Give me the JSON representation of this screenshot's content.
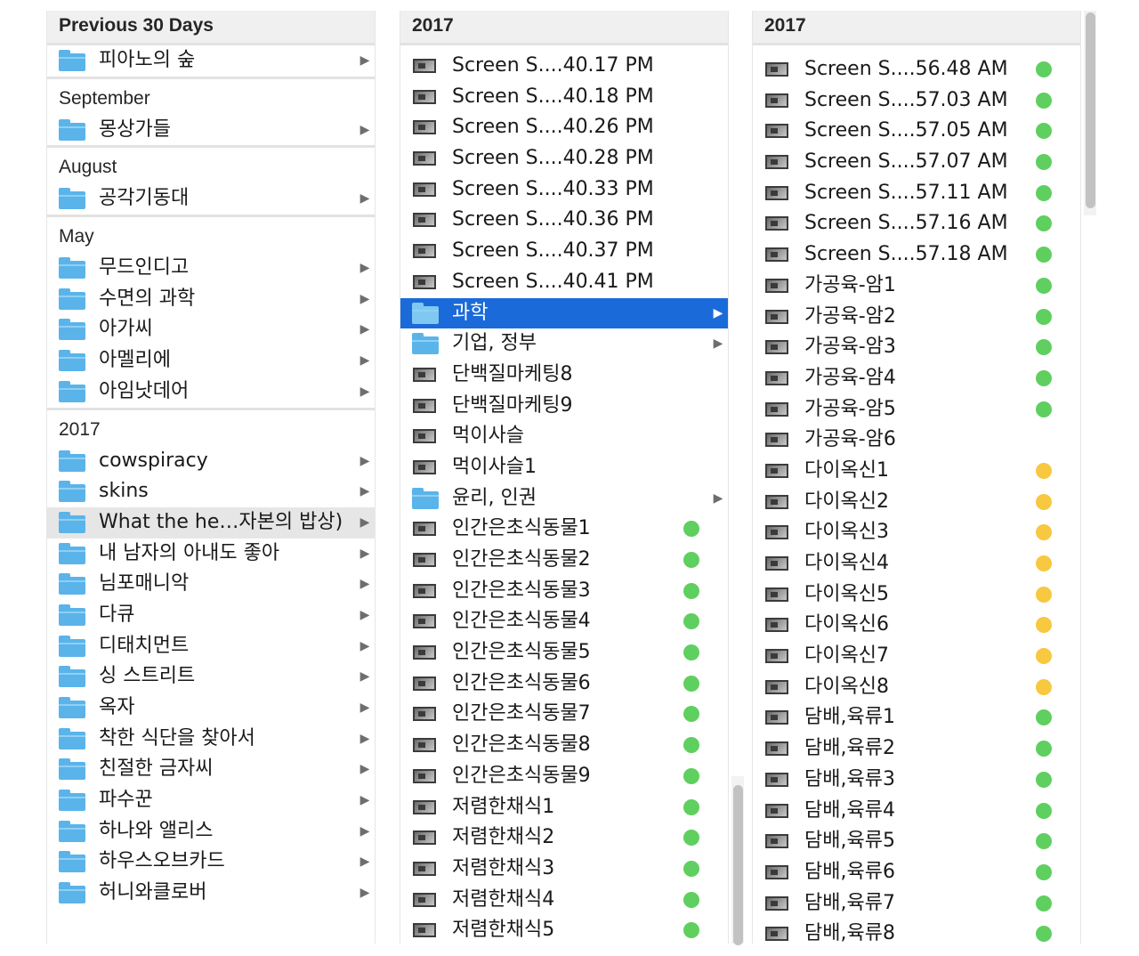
{
  "colors": {
    "green": "#5fcf5f",
    "yellow": "#f7c840",
    "selection": "#1b6ad9"
  },
  "columns": [
    {
      "header": "Previous 30 Days",
      "items": [
        {
          "label": "피아노의 숲"
        }
      ],
      "sections": [
        {
          "title": "September",
          "items": [
            {
              "label": "몽상가들"
            }
          ]
        },
        {
          "title": "August",
          "items": [
            {
              "label": "공각기동대"
            }
          ]
        },
        {
          "title": "May",
          "items": [
            {
              "label": "무드인디고"
            },
            {
              "label": "수면의 과학"
            },
            {
              "label": "아가씨"
            },
            {
              "label": "아멜리에"
            },
            {
              "label": "아임낫데어"
            }
          ]
        },
        {
          "title": "2017",
          "items": [
            {
              "label": "cowspiracy"
            },
            {
              "label": "skins"
            },
            {
              "label": "What the he…자본의 밥상)",
              "highlight": true
            },
            {
              "label": "내 남자의 아내도 좋아"
            },
            {
              "label": "님포매니악"
            },
            {
              "label": "다큐"
            },
            {
              "label": "디태치먼트"
            },
            {
              "label": "싱 스트리트"
            },
            {
              "label": "옥자"
            },
            {
              "label": "착한 식단을 찾아서"
            },
            {
              "label": "친절한 금자씨"
            },
            {
              "label": "파수꾼"
            },
            {
              "label": "하나와 앨리스"
            },
            {
              "label": "하우스오브카드"
            },
            {
              "label": "허니와클로버"
            }
          ]
        }
      ]
    },
    {
      "header": "2017",
      "items": [
        {
          "label": "Screen S....40.17 PM",
          "kind": "file"
        },
        {
          "label": "Screen S....40.18 PM",
          "kind": "file"
        },
        {
          "label": "Screen S....40.26 PM",
          "kind": "file"
        },
        {
          "label": "Screen S....40.28 PM",
          "kind": "file"
        },
        {
          "label": "Screen S....40.33 PM",
          "kind": "file"
        },
        {
          "label": "Screen S....40.36 PM",
          "kind": "file"
        },
        {
          "label": "Screen S....40.37 PM",
          "kind": "file"
        },
        {
          "label": "Screen S....40.41 PM",
          "kind": "file"
        },
        {
          "label": "과학",
          "kind": "folder",
          "selected": true
        },
        {
          "label": "기업, 정부",
          "kind": "folder"
        },
        {
          "label": "단백질마케팅8",
          "kind": "file"
        },
        {
          "label": "단백질마케팅9",
          "kind": "file"
        },
        {
          "label": "먹이사슬",
          "kind": "file"
        },
        {
          "label": "먹이사슬1",
          "kind": "file"
        },
        {
          "label": "윤리, 인권",
          "kind": "folder"
        },
        {
          "label": "인간은초식동물1",
          "kind": "file",
          "tag": "green"
        },
        {
          "label": "인간은초식동물2",
          "kind": "file",
          "tag": "green"
        },
        {
          "label": "인간은초식동물3",
          "kind": "file",
          "tag": "green"
        },
        {
          "label": "인간은초식동물4",
          "kind": "file",
          "tag": "green"
        },
        {
          "label": "인간은초식동물5",
          "kind": "file",
          "tag": "green"
        },
        {
          "label": "인간은초식동물6",
          "kind": "file",
          "tag": "green"
        },
        {
          "label": "인간은초식동물7",
          "kind": "file",
          "tag": "green"
        },
        {
          "label": "인간은초식동물8",
          "kind": "file",
          "tag": "green"
        },
        {
          "label": "인간은초식동물9",
          "kind": "file",
          "tag": "green"
        },
        {
          "label": "저렴한채식1",
          "kind": "file",
          "tag": "green"
        },
        {
          "label": "저렴한채식2",
          "kind": "file",
          "tag": "green"
        },
        {
          "label": "저렴한채식3",
          "kind": "file",
          "tag": "green"
        },
        {
          "label": "저렴한채식4",
          "kind": "file",
          "tag": "green"
        },
        {
          "label": "저렴한채식5",
          "kind": "file",
          "tag": "green"
        }
      ]
    },
    {
      "header": "2017",
      "items": [
        {
          "label": "Screen S....56.48 AM",
          "kind": "file",
          "tag": "green"
        },
        {
          "label": "Screen S....57.03 AM",
          "kind": "file",
          "tag": "green"
        },
        {
          "label": "Screen S....57.05 AM",
          "kind": "file",
          "tag": "green"
        },
        {
          "label": "Screen S....57.07 AM",
          "kind": "file",
          "tag": "green"
        },
        {
          "label": "Screen S....57.11 AM",
          "kind": "file",
          "tag": "green"
        },
        {
          "label": "Screen S....57.16 AM",
          "kind": "file",
          "tag": "green"
        },
        {
          "label": "Screen S....57.18 AM",
          "kind": "file",
          "tag": "green"
        },
        {
          "label": "가공육-암1",
          "kind": "file",
          "tag": "green"
        },
        {
          "label": "가공육-암2",
          "kind": "file",
          "tag": "green"
        },
        {
          "label": "가공육-암3",
          "kind": "file",
          "tag": "green"
        },
        {
          "label": "가공육-암4",
          "kind": "file",
          "tag": "green"
        },
        {
          "label": "가공육-암5",
          "kind": "file",
          "tag": "green"
        },
        {
          "label": "가공육-암6",
          "kind": "file"
        },
        {
          "label": "다이옥신1",
          "kind": "file",
          "tag": "yellow"
        },
        {
          "label": "다이옥신2",
          "kind": "file",
          "tag": "yellow"
        },
        {
          "label": "다이옥신3",
          "kind": "file",
          "tag": "yellow"
        },
        {
          "label": "다이옥신4",
          "kind": "file",
          "tag": "yellow"
        },
        {
          "label": "다이옥신5",
          "kind": "file",
          "tag": "yellow"
        },
        {
          "label": "다이옥신6",
          "kind": "file",
          "tag": "yellow"
        },
        {
          "label": "다이옥신7",
          "kind": "file",
          "tag": "yellow"
        },
        {
          "label": "다이옥신8",
          "kind": "file",
          "tag": "yellow"
        },
        {
          "label": "담배,육류1",
          "kind": "file",
          "tag": "green"
        },
        {
          "label": "담배,육류2",
          "kind": "file",
          "tag": "green"
        },
        {
          "label": "담배,육류3",
          "kind": "file",
          "tag": "green"
        },
        {
          "label": "담배,육류4",
          "kind": "file",
          "tag": "green"
        },
        {
          "label": "담배,육류5",
          "kind": "file",
          "tag": "green"
        },
        {
          "label": "담배,육류6",
          "kind": "file",
          "tag": "green"
        },
        {
          "label": "담배,육류7",
          "kind": "file",
          "tag": "green"
        },
        {
          "label": "담배,육류8",
          "kind": "file",
          "tag": "green"
        }
      ]
    }
  ]
}
